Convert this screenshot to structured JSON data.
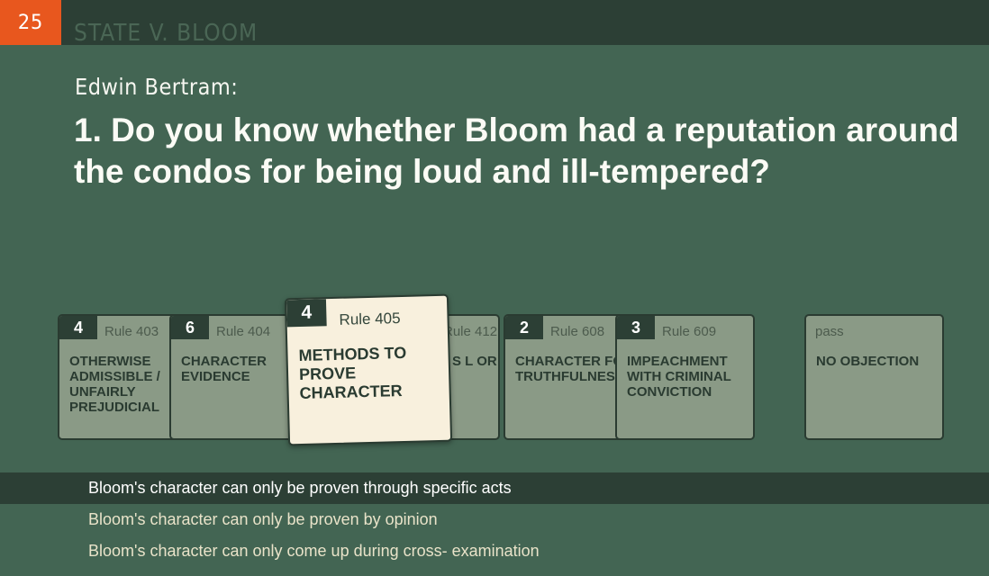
{
  "header": {
    "score": "25",
    "case_title": "STATE V. BLOOM"
  },
  "speaker": "Edwin Bertram:",
  "question": "1. Do you know whether Bloom had a reputation around the condos for being loud and ill-tempered?",
  "cards": [
    {
      "count": "4",
      "rule": "Rule 403",
      "title": "OTHERWISE ADMISSIBLE / UNFAIRLY PREJUDICIAL"
    },
    {
      "count": "6",
      "rule": "Rule 404",
      "title": "CHARACTER EVIDENCE"
    },
    {
      "count": "",
      "rule": "Rule 412",
      "title": "S L OR"
    },
    {
      "count": "2",
      "rule": "Rule 608",
      "title": "CHARACTER FOR TRUTHFULNESS"
    },
    {
      "count": "3",
      "rule": "Rule 609",
      "title": "IMPEACHMENT WITH CRIMINAL CONVICTION"
    },
    {
      "count": "",
      "rule": "pass",
      "title": "NO OBJECTION"
    }
  ],
  "active_card": {
    "count": "4",
    "rule": "Rule 405",
    "title": "METHODS TO PROVE CHARACTER"
  },
  "answers": [
    "Bloom's character can only be proven through specific acts",
    "Bloom's character can only be proven by opinion",
    "Bloom's character can only come up during cross- examination"
  ],
  "colors": {
    "background": "#436553",
    "bar": "#2c3f35",
    "score_badge": "#e8571e",
    "card": "#8a9a86",
    "active_card": "#f8f0dd"
  }
}
